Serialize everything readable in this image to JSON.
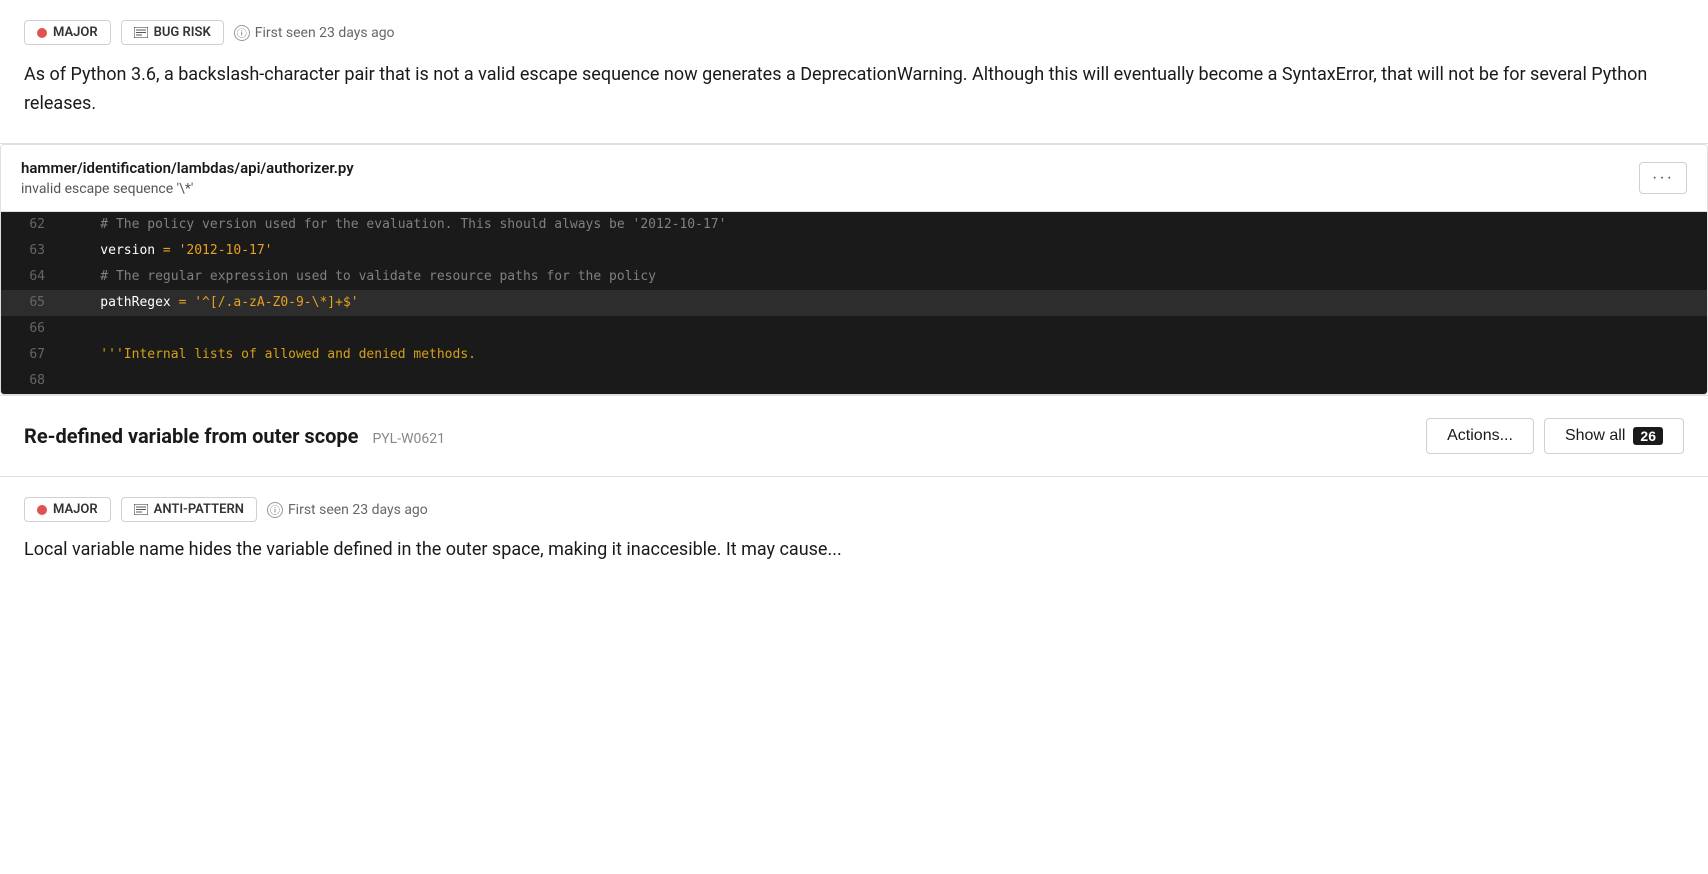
{
  "top_section": {
    "badges": [
      {
        "type": "dot",
        "label": "MAJOR",
        "dot_color": "#e05252"
      },
      {
        "type": "icon",
        "label": "BUG RISK"
      }
    ],
    "first_seen": "First seen 23 days ago",
    "description": "As of Python 3.6, a backslash-character pair that is not a valid escape sequence now generates a DeprecationWarning. Although this will eventually become a SyntaxError, that will not be for several Python releases."
  },
  "file_section": {
    "file_path": "hammer/identification/lambdas/api/authorizer.py",
    "subtitle": "invalid escape sequence '\\*'",
    "more_button_label": "···",
    "code_lines": [
      {
        "number": "62",
        "content": "    # The policy version used for the evaluation. This should always be '2012-10-17'",
        "type": "comment",
        "highlighted": false
      },
      {
        "number": "63",
        "content_parts": [
          {
            "text": "    version",
            "class": "c-keyword"
          },
          {
            "text": " = ",
            "class": "c-operator"
          },
          {
            "text": "'2012-10-17'",
            "class": "c-string"
          }
        ],
        "highlighted": false
      },
      {
        "number": "64",
        "content": "    # The regular expression used to validate resource paths for the policy",
        "type": "comment",
        "highlighted": false
      },
      {
        "number": "65",
        "content_parts": [
          {
            "text": "    pathRegex",
            "class": "c-keyword"
          },
          {
            "text": " = ",
            "class": "c-operator"
          },
          {
            "text": "'^[/.a-zA-Z0-9-\\*]+$'",
            "class": "c-string"
          }
        ],
        "highlighted": true
      },
      {
        "number": "66",
        "content": "",
        "type": "empty",
        "highlighted": false
      },
      {
        "number": "67",
        "content_parts": [
          {
            "text": "    '''Internal lists of ",
            "class": "c-string-yellow"
          },
          {
            "text": "allowed",
            "class": "c-string-yellow"
          },
          {
            "text": " and denied methods.",
            "class": "c-string-yellow"
          }
        ],
        "highlighted": false
      },
      {
        "number": "68",
        "content": "",
        "type": "empty",
        "highlighted": false
      }
    ]
  },
  "issue_group": {
    "title": "Re-defined variable from outer scope",
    "tag": "PYL-W0621",
    "actions_button_label": "Actions...",
    "show_all_label": "Show all",
    "show_all_count": "26"
  },
  "bottom_issue": {
    "badges": [
      {
        "type": "dot",
        "label": "MAJOR",
        "dot_color": "#e05252"
      },
      {
        "type": "icon",
        "label": "ANTI-PATTERN"
      }
    ],
    "first_seen": "First seen 23 days ago",
    "description": "Local variable name hides the variable defined in the outer space, making it inaccesible. It may cause..."
  }
}
